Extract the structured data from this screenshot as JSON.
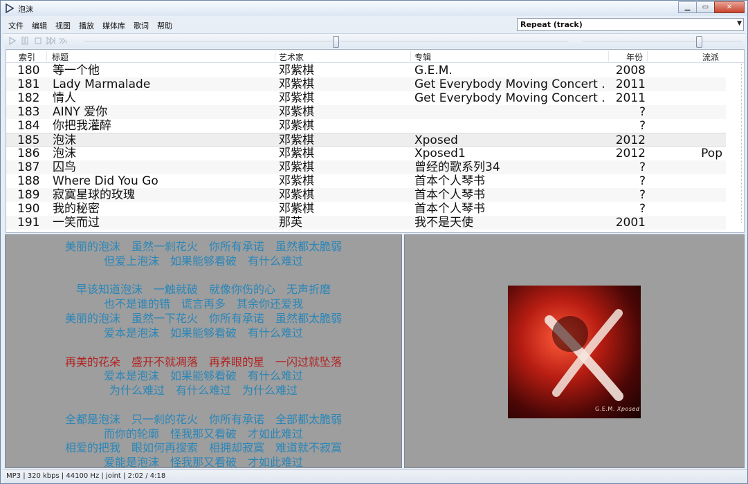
{
  "window": {
    "title": "泡沫"
  },
  "menu": {
    "items": [
      {
        "label": "文件"
      },
      {
        "label": "编辑"
      },
      {
        "label": "视图"
      },
      {
        "label": "播放"
      },
      {
        "label": "媒体库"
      },
      {
        "label": "歌词"
      },
      {
        "label": "帮助"
      }
    ]
  },
  "playback_order": {
    "selected": "Repeat (track)"
  },
  "toolbar": {
    "buttons": [
      "play-icon",
      "pause-icon",
      "stop-icon",
      "next-icon",
      "random-icon"
    ],
    "seek_position_fraction": 0.52,
    "volume_fraction": 0.73
  },
  "playlist": {
    "columns": {
      "index": "索引",
      "title": "标题",
      "artist": "艺术家",
      "album": "专辑",
      "year": "年份",
      "genre": "流派"
    },
    "rows": [
      {
        "index": "180",
        "title": "等一个他",
        "artist": "邓紫棋",
        "album": "G.E.M.",
        "year": "2008",
        "genre": ""
      },
      {
        "index": "181",
        "title": "Lady Marmalade",
        "artist": "邓紫棋",
        "album": "Get Everybody Moving Concert ...",
        "year": "2011",
        "genre": ""
      },
      {
        "index": "182",
        "title": "情人",
        "artist": "邓紫棋",
        "album": "Get Everybody Moving Concert ...",
        "year": "2011",
        "genre": ""
      },
      {
        "index": "183",
        "title": "AINY 爱你",
        "artist": "邓紫棋",
        "album": "",
        "year": "?",
        "genre": ""
      },
      {
        "index": "184",
        "title": "你把我灌醉",
        "artist": "邓紫棋",
        "album": "",
        "year": "?",
        "genre": ""
      },
      {
        "index": "185",
        "title": "泡沫",
        "artist": "邓紫棋",
        "album": "Xposed",
        "year": "2012",
        "genre": ""
      },
      {
        "index": "186",
        "title": "泡沫",
        "artist": "邓紫棋",
        "album": "Xposed1",
        "year": "2012",
        "genre": "Pop"
      },
      {
        "index": "187",
        "title": "囚鸟",
        "artist": "邓紫棋",
        "album": "曾经的歌系列34",
        "year": "?",
        "genre": ""
      },
      {
        "index": "188",
        "title": "Where Did You Go",
        "artist": "邓紫棋",
        "album": "首本个人琴书",
        "year": "?",
        "genre": ""
      },
      {
        "index": "189",
        "title": "寂寞星球的玫瑰",
        "artist": "邓紫棋",
        "album": "首本个人琴书",
        "year": "?",
        "genre": ""
      },
      {
        "index": "190",
        "title": "我的秘密",
        "artist": "邓紫棋",
        "album": "首本个人琴书",
        "year": "?",
        "genre": ""
      },
      {
        "index": "191",
        "title": "一笑而过",
        "artist": "那英",
        "album": "我不是天使",
        "year": "2001",
        "genre": ""
      }
    ]
  },
  "lyrics": {
    "lines": [
      {
        "text": "美丽的泡沫　虽然一刹花火　你所有承诺　虽然都太脆弱",
        "state": "normal"
      },
      {
        "text": "但爱上泡沫　如果能够看破　有什么难过",
        "state": "normal"
      },
      {
        "text": "",
        "state": "normal"
      },
      {
        "text": "早该知道泡沫　一触就破　就像你伤的心　无声折磨",
        "state": "normal"
      },
      {
        "text": "也不是谁的错　谎言再多　其余你还爱我",
        "state": "normal"
      },
      {
        "text": "美丽的泡沫　虽然一下花火　你所有承诺　虽然都太脆弱",
        "state": "normal"
      },
      {
        "text": "爱本是泡沫　如果能够看破　有什么难过",
        "state": "normal"
      },
      {
        "text": "",
        "state": "normal"
      },
      {
        "text": "再美的花朵　盛开不就凋落　再养眼的星　一闪过就坠落",
        "state": "current"
      },
      {
        "text": "爱本是泡沫　如果能够看破　有什么难过",
        "state": "normal"
      },
      {
        "text": "为什么难过　有什么难过　为什么难过",
        "state": "normal"
      },
      {
        "text": "",
        "state": "normal"
      },
      {
        "text": "全都是泡沫　只一刹的花火　你所有承诺　全部都太脆弱",
        "state": "normal"
      },
      {
        "text": "而你的轮廓　怪我那又看破　才如此难过",
        "state": "normal"
      },
      {
        "text": "相爱的把我　眼如何再搜索　相拥却寂寞　难道就不寂寞",
        "state": "normal"
      },
      {
        "text": "爱能是泡沫　怪我那又看破　才如此难过",
        "state": "normal"
      }
    ]
  },
  "cover": {
    "brand": "G.E.M.",
    "album": "Xposed"
  },
  "status": {
    "text": "MP3 | 320 kbps | 44100 Hz | joint | 2:02 / 4:18"
  },
  "colors": {
    "lyric_normal": "#2a86b8",
    "lyric_current": "#b32020",
    "pane_background": "#9e9e9e"
  }
}
